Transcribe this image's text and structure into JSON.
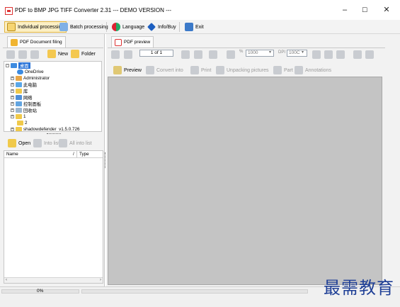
{
  "window": {
    "title": "PDF to BMP JPG TIFF Converter 2.31 --- DEMO VERSION ---",
    "controls": {
      "minimize": "–",
      "maximize": "☐",
      "close": "✕"
    }
  },
  "toolbar": {
    "individual_processing": "Individual processing",
    "batch_processing": "Batch processing",
    "language": "Language",
    "info_buy": "Info/Buy",
    "exit": "Exit"
  },
  "left_panel": {
    "tab_label": "PDF Document filing",
    "new_label": "New",
    "folder_label": "Folder",
    "tree": [
      {
        "label": "桌面",
        "selected": true
      },
      {
        "label": "OneDrive"
      },
      {
        "label": "Administrator"
      },
      {
        "label": "此电脑"
      },
      {
        "label": "库"
      },
      {
        "label": "网络"
      },
      {
        "label": "控制面板"
      },
      {
        "label": "回收站"
      },
      {
        "label": "1"
      },
      {
        "label": "2"
      },
      {
        "label": "shadowdefender_v1.5.0.726"
      }
    ],
    "open_label": "Open",
    "into_list_label": "Into list",
    "all_into_list_label": "All into list",
    "columns": {
      "name": "Name",
      "sort_marker": "/",
      "type": "Type"
    }
  },
  "right_panel": {
    "tab_label": "PDF preview",
    "page_indicator": "1 of 1",
    "zoom_value": "1000",
    "dpi_label": "DPI",
    "dpi_value": "100C",
    "preview_label": "Preview",
    "convert_into_label": "Convert into",
    "print_label": "Print",
    "unpacking_pictures_label": "Unpacking pictures",
    "part_label": "Part",
    "annotations_label": "Annotations"
  },
  "status": {
    "progress_text": "0%"
  },
  "watermark": {
    "text": "最需教育"
  },
  "colors": {
    "selection": "#2a74d8",
    "active_tab": "#fcefc4",
    "preview_bg": "#c4c4c4",
    "folder": "#f0c94a"
  }
}
